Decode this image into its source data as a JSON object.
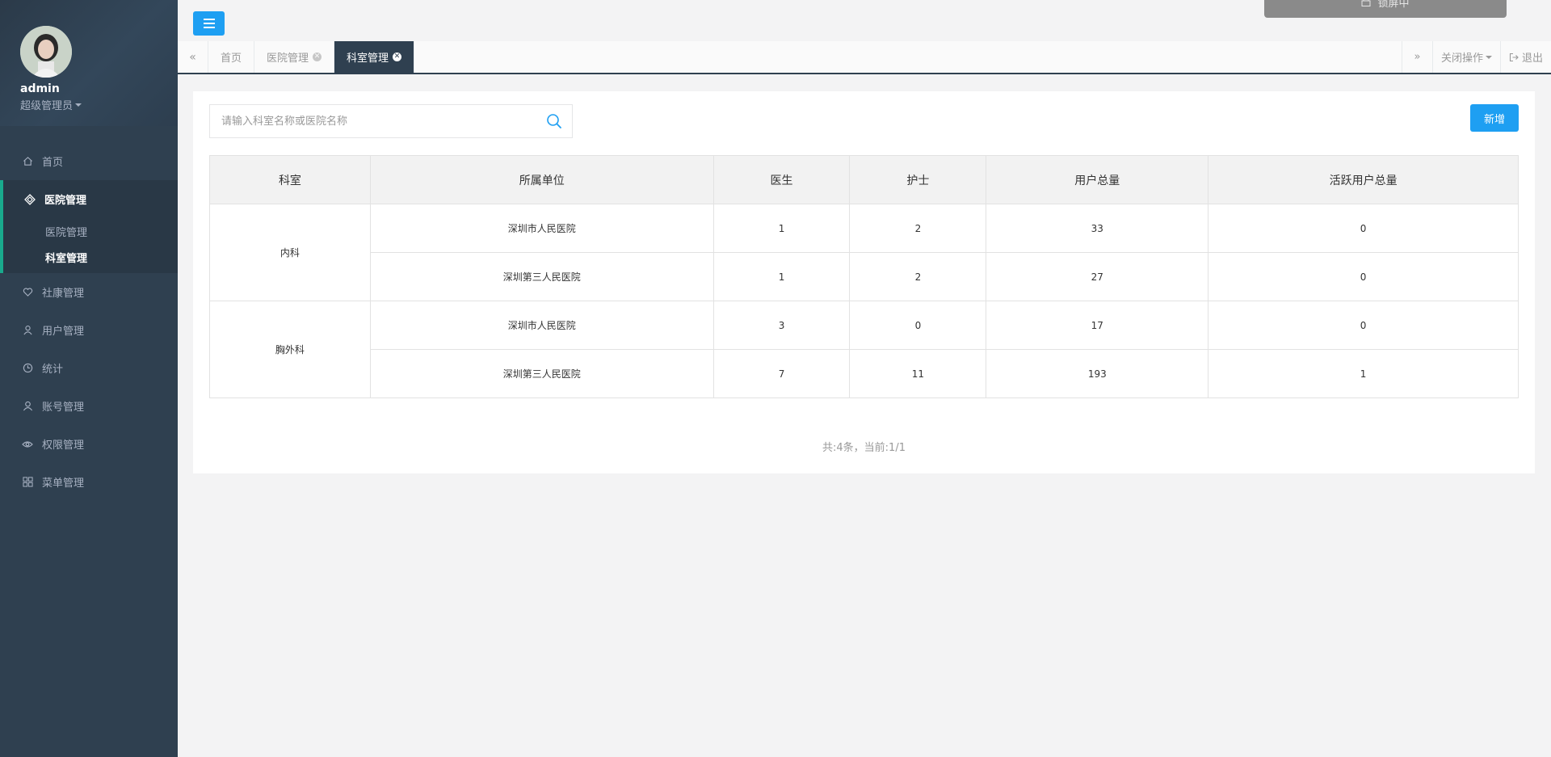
{
  "sidebar": {
    "user_name": "admin",
    "user_role": "超级管理员",
    "items": [
      {
        "label": "首页",
        "icon": "home-icon"
      },
      {
        "label": "医院管理",
        "icon": "diamond-icon"
      },
      {
        "label": "社康管理",
        "icon": "heart-icon"
      },
      {
        "label": "用户管理",
        "icon": "user-icon"
      },
      {
        "label": "统计",
        "icon": "clock-icon"
      },
      {
        "label": "账号管理",
        "icon": "account-icon"
      },
      {
        "label": "权限管理",
        "icon": "eye-icon"
      },
      {
        "label": "菜单管理",
        "icon": "grid-icon"
      }
    ],
    "sub_items": [
      {
        "label": "医院管理"
      },
      {
        "label": "科室管理"
      }
    ]
  },
  "topbar": {
    "lock_text": "锁屏中"
  },
  "tabs": {
    "left_arrow": "«",
    "right_arrow": "»",
    "items": [
      {
        "label": "首页"
      },
      {
        "label": "医院管理"
      },
      {
        "label": "科室管理"
      }
    ],
    "close_ops": "关闭操作",
    "logout": "退出"
  },
  "search": {
    "placeholder": "请输入科室名称或医院名称"
  },
  "toolbar": {
    "add_label": "新增"
  },
  "table": {
    "headers": [
      "科室",
      "所属单位",
      "医生",
      "护士",
      "用户总量",
      "活跃用户总量"
    ],
    "groups": [
      {
        "dept": "内科",
        "rows": [
          {
            "unit": "深圳市人民医院",
            "doctors": "1",
            "nurses": "2",
            "users": "33",
            "active": "0"
          },
          {
            "unit": "深圳第三人民医院",
            "doctors": "1",
            "nurses": "2",
            "users": "27",
            "active": "0"
          }
        ]
      },
      {
        "dept": "胸外科",
        "rows": [
          {
            "unit": "深圳市人民医院",
            "doctors": "3",
            "nurses": "0",
            "users": "17",
            "active": "0"
          },
          {
            "unit": "深圳第三人民医院",
            "doctors": "7",
            "nurses": "11",
            "users": "193",
            "active": "1"
          }
        ]
      }
    ]
  },
  "pager": {
    "text": "共:4条，当前:1/1"
  },
  "colors": {
    "sidebar_bg": "#2f4050",
    "accent_green": "#19aa8d",
    "primary_blue": "#1e9ff2"
  }
}
